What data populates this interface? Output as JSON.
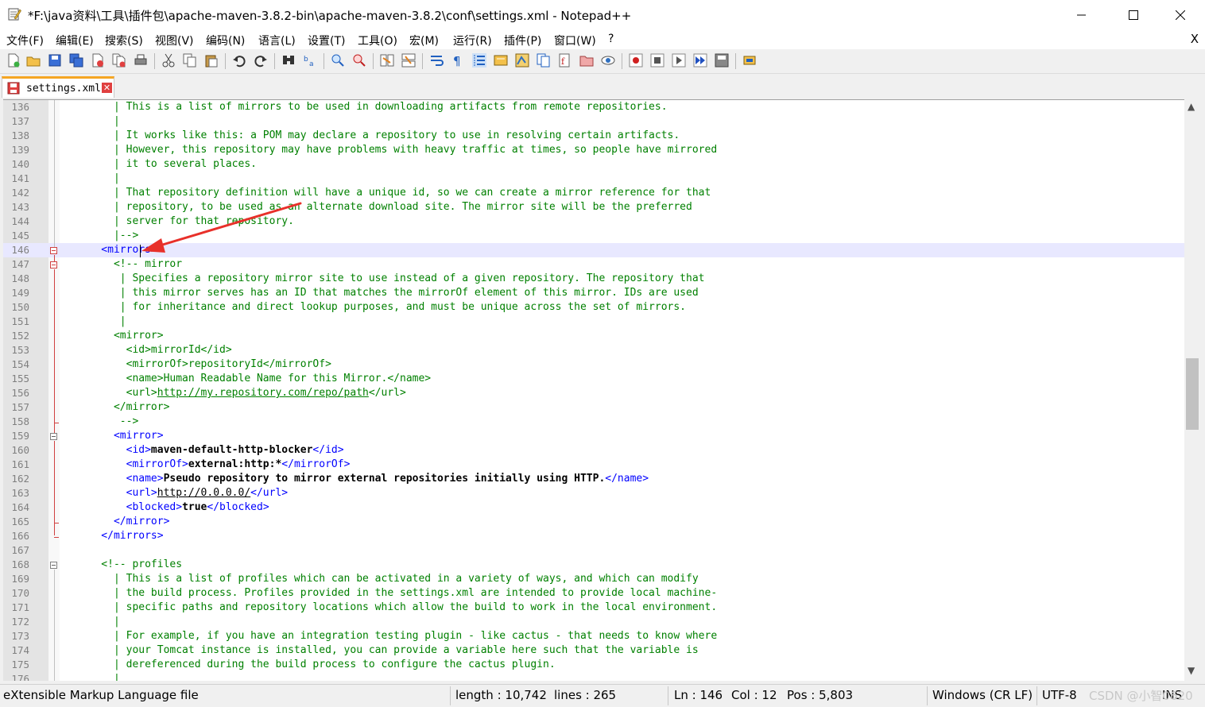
{
  "window": {
    "title": "*F:\\java资料\\工具\\插件包\\apache-maven-3.8.2-bin\\apache-maven-3.8.2\\conf\\settings.xml - Notepad++",
    "minimize_icon": "minimize-icon",
    "maximize_icon": "maximize-icon",
    "close_icon": "close-icon"
  },
  "menu": {
    "items": [
      "文件(F)",
      "编辑(E)",
      "搜索(S)",
      "视图(V)",
      "编码(N)",
      "语言(L)",
      "设置(T)",
      "工具(O)",
      "宏(M)",
      "运行(R)",
      "插件(P)",
      "窗口(W)",
      "?"
    ],
    "close_label": "X"
  },
  "toolbar": {
    "icons": [
      "new-file-icon",
      "open-file-icon",
      "save-icon",
      "save-all-icon",
      "close-icon",
      "close-all-icon",
      "print-icon",
      "cut-icon",
      "copy-icon",
      "paste-icon",
      "undo-icon",
      "redo-icon",
      "find-icon",
      "replace-icon",
      "zoom-in-icon",
      "zoom-out-icon",
      "sync-vertical-icon",
      "sync-horizontal-icon",
      "word-wrap-icon",
      "show-all-characters-icon",
      "indent-guide-icon",
      "user-language-icon",
      "document-map-icon",
      "document-list-icon",
      "function-list-icon",
      "folder-workspace-icon",
      "monitoring-icon",
      "record-macro-icon",
      "stop-recording-icon",
      "play-macro-icon",
      "run-macro-multiple-icon",
      "save-macro-icon",
      "plugin-icon"
    ]
  },
  "tab": {
    "label": "settings.xml",
    "icon": "unsaved-file-icon",
    "close_label": "✕"
  },
  "editor": {
    "current_line": 146,
    "lines": [
      {
        "n": "136",
        "segs": [
          {
            "t": "      | This is a list of mirrors to be used in downloading artifacts from remote repositories.",
            "c": "c-com"
          }
        ]
      },
      {
        "n": "137",
        "segs": [
          {
            "t": "      |",
            "c": "c-com"
          }
        ]
      },
      {
        "n": "138",
        "segs": [
          {
            "t": "      | It works like this: a POM may declare a repository to use in resolving certain artifacts.",
            "c": "c-com"
          }
        ]
      },
      {
        "n": "139",
        "segs": [
          {
            "t": "      | However, this repository may have problems with heavy traffic at times, so people have mirrored",
            "c": "c-com"
          }
        ]
      },
      {
        "n": "140",
        "segs": [
          {
            "t": "      | it to several places.",
            "c": "c-com"
          }
        ]
      },
      {
        "n": "141",
        "segs": [
          {
            "t": "      |",
            "c": "c-com"
          }
        ]
      },
      {
        "n": "142",
        "segs": [
          {
            "t": "      | That repository definition will have a unique id, so we can create a mirror reference for that",
            "c": "c-com"
          }
        ]
      },
      {
        "n": "143",
        "segs": [
          {
            "t": "      | repository, to be used as an alternate download site. The mirror site will be the preferred",
            "c": "c-com"
          }
        ]
      },
      {
        "n": "144",
        "segs": [
          {
            "t": "      | server for that repository.",
            "c": "c-com"
          }
        ]
      },
      {
        "n": "145",
        "segs": [
          {
            "t": "      |-->",
            "c": "c-com"
          }
        ]
      },
      {
        "n": "146",
        "segs": [
          {
            "t": "    <mirrors>",
            "c": "c-tag"
          }
        ]
      },
      {
        "n": "147",
        "segs": [
          {
            "t": "      <!-- mirror",
            "c": "c-com"
          }
        ]
      },
      {
        "n": "148",
        "segs": [
          {
            "t": "       | Specifies a repository mirror site to use instead of a given repository. The repository that",
            "c": "c-com"
          }
        ]
      },
      {
        "n": "149",
        "segs": [
          {
            "t": "       | this mirror serves has an ID that matches the mirrorOf element of this mirror. IDs are used",
            "c": "c-com"
          }
        ]
      },
      {
        "n": "150",
        "segs": [
          {
            "t": "       | for inheritance and direct lookup purposes, and must be unique across the set of mirrors.",
            "c": "c-com"
          }
        ]
      },
      {
        "n": "151",
        "segs": [
          {
            "t": "       |",
            "c": "c-com"
          }
        ]
      },
      {
        "n": "152",
        "segs": [
          {
            "t": "      <mirror>",
            "c": "c-com"
          }
        ]
      },
      {
        "n": "153",
        "segs": [
          {
            "t": "        <id>mirrorId</id>",
            "c": "c-com"
          }
        ]
      },
      {
        "n": "154",
        "segs": [
          {
            "t": "        <mirrorOf>repositoryId</mirrorOf>",
            "c": "c-com"
          }
        ]
      },
      {
        "n": "155",
        "segs": [
          {
            "t": "        <name>Human Readable Name for this Mirror.</name>",
            "c": "c-com"
          }
        ]
      },
      {
        "n": "156",
        "segs": [
          {
            "t": "        <url>",
            "c": "c-com"
          },
          {
            "t": "http://my.repository.com/repo/path",
            "c": "c-com-url"
          },
          {
            "t": "</url>",
            "c": "c-com"
          }
        ]
      },
      {
        "n": "157",
        "segs": [
          {
            "t": "      </mirror>",
            "c": "c-com"
          }
        ]
      },
      {
        "n": "158",
        "segs": [
          {
            "t": "       -->",
            "c": "c-com"
          }
        ]
      },
      {
        "n": "159",
        "segs": [
          {
            "t": "      <mirror>",
            "c": "c-tag"
          }
        ]
      },
      {
        "n": "160",
        "segs": [
          {
            "t": "        <id>",
            "c": "c-tag"
          },
          {
            "t": "maven-default-http-blocker",
            "c": "c-bold"
          },
          {
            "t": "</id>",
            "c": "c-tag"
          }
        ]
      },
      {
        "n": "161",
        "segs": [
          {
            "t": "        <mirrorOf>",
            "c": "c-tag"
          },
          {
            "t": "external:http:*",
            "c": "c-bold"
          },
          {
            "t": "</mirrorOf>",
            "c": "c-tag"
          }
        ]
      },
      {
        "n": "162",
        "segs": [
          {
            "t": "        <name>",
            "c": "c-tag"
          },
          {
            "t": "Pseudo repository to mirror external repositories initially using HTTP.",
            "c": "c-bold"
          },
          {
            "t": "</name>",
            "c": "c-tag"
          }
        ]
      },
      {
        "n": "163",
        "segs": [
          {
            "t": "        <url>",
            "c": "c-tag"
          },
          {
            "t": "http://0.0.0.0/",
            "c": "c-url"
          },
          {
            "t": "</url>",
            "c": "c-tag"
          }
        ]
      },
      {
        "n": "164",
        "segs": [
          {
            "t": "        <blocked>",
            "c": "c-tag"
          },
          {
            "t": "true",
            "c": "c-bold"
          },
          {
            "t": "</blocked>",
            "c": "c-tag"
          }
        ]
      },
      {
        "n": "165",
        "segs": [
          {
            "t": "      </mirror>",
            "c": "c-tag"
          }
        ]
      },
      {
        "n": "166",
        "segs": [
          {
            "t": "    </mirrors>",
            "c": "c-tag"
          }
        ]
      },
      {
        "n": "167",
        "segs": [
          {
            "t": "",
            "c": "c-txt"
          }
        ]
      },
      {
        "n": "168",
        "segs": [
          {
            "t": "    <!-- profiles",
            "c": "c-com"
          }
        ]
      },
      {
        "n": "169",
        "segs": [
          {
            "t": "      | This is a list of profiles which can be activated in a variety of ways, and which can modify",
            "c": "c-com"
          }
        ]
      },
      {
        "n": "170",
        "segs": [
          {
            "t": "      | the build process. Profiles provided in the settings.xml are intended to provide local machine-",
            "c": "c-com"
          }
        ]
      },
      {
        "n": "171",
        "segs": [
          {
            "t": "      | specific paths and repository locations which allow the build to work in the local environment.",
            "c": "c-com"
          }
        ]
      },
      {
        "n": "172",
        "segs": [
          {
            "t": "      |",
            "c": "c-com"
          }
        ]
      },
      {
        "n": "173",
        "segs": [
          {
            "t": "      | For example, if you have an integration testing plugin - like cactus - that needs to know where",
            "c": "c-com"
          }
        ]
      },
      {
        "n": "174",
        "segs": [
          {
            "t": "      | your Tomcat instance is installed, you can provide a variable here such that the variable is",
            "c": "c-com"
          }
        ]
      },
      {
        "n": "175",
        "segs": [
          {
            "t": "      | dereferenced during the build process to configure the cactus plugin.",
            "c": "c-com"
          }
        ]
      },
      {
        "n": "176",
        "segs": [
          {
            "t": "      |",
            "c": "c-com"
          }
        ]
      }
    ]
  },
  "statusbar": {
    "file_type": "eXtensible Markup Language file",
    "length": "length : 10,742",
    "lines": "lines : 265",
    "ln": "Ln : 146",
    "col": "Col : 12",
    "pos": "Pos : 5,803",
    "eol": "Windows (CR LF)",
    "encoding": "UTF-8",
    "mode": "INS",
    "watermark": "CSDN @小智0620"
  },
  "colors": {
    "comment": "#008000",
    "tag": "#0000ff",
    "annotation_arrow": "#e8302a",
    "tab_accent": "#f5a623"
  }
}
